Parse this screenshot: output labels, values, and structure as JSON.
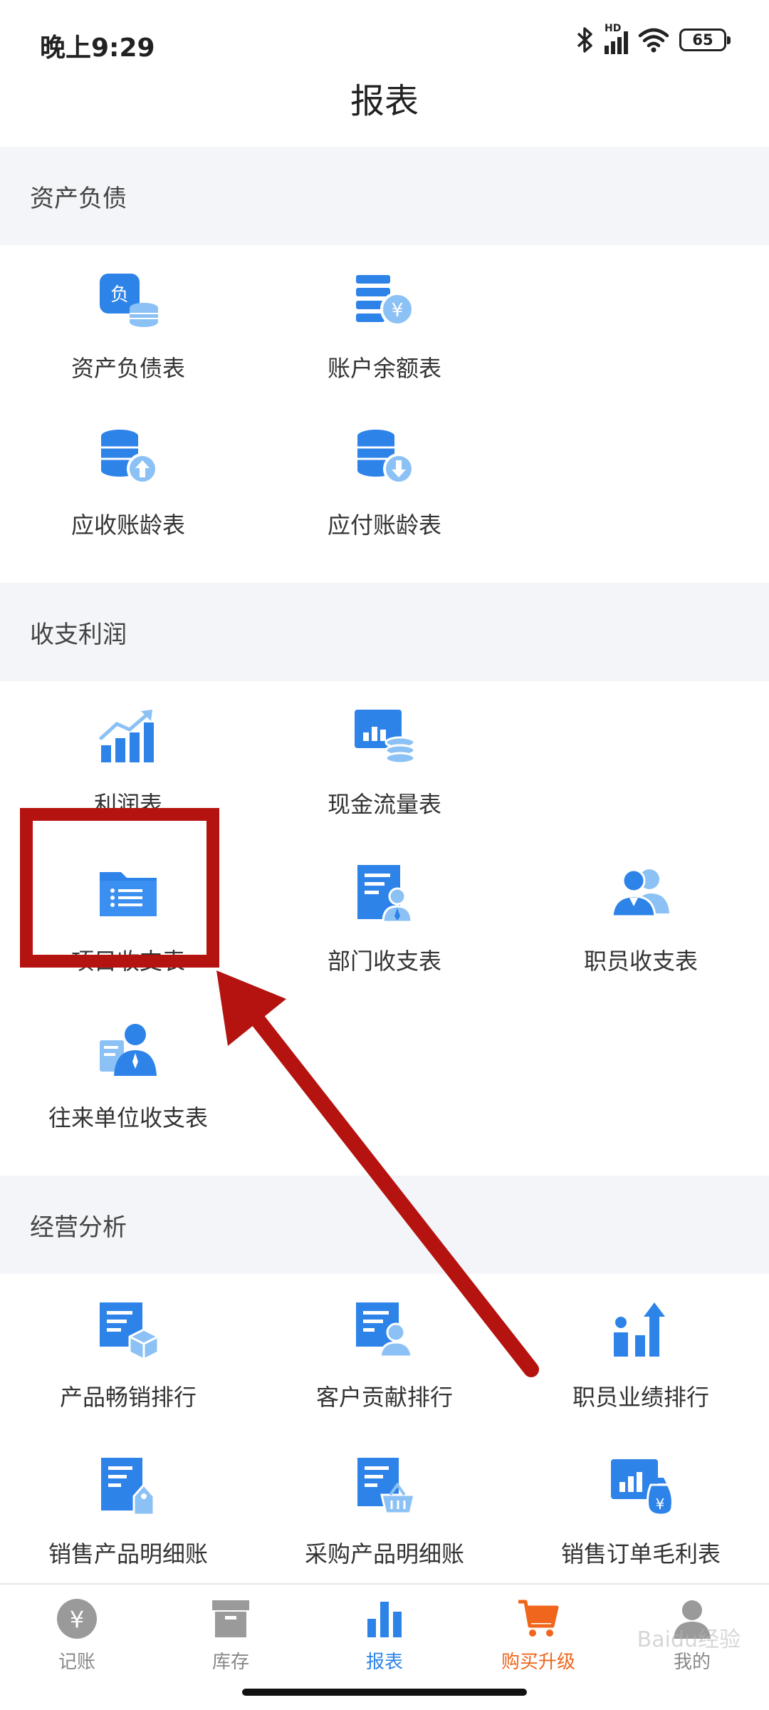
{
  "status_bar": {
    "time": "晚上9:29",
    "network": "HD",
    "battery": "65"
  },
  "page": {
    "title": "报表"
  },
  "sections": [
    {
      "title": "资产负债",
      "items": [
        {
          "label": "资产负债表",
          "icon": "liability-coins-icon"
        },
        {
          "label": "账户余额表",
          "icon": "account-yuan-icon"
        },
        {
          "label": "应收账龄表",
          "icon": "receivable-up-icon"
        },
        {
          "label": "应付账龄表",
          "icon": "payable-down-icon"
        }
      ]
    },
    {
      "title": "收支利润",
      "items": [
        {
          "label": "利润表",
          "icon": "profit-chart-icon"
        },
        {
          "label": "现金流量表",
          "icon": "cashflow-icon"
        },
        {
          "label": "项目收支表",
          "icon": "project-folder-icon"
        },
        {
          "label": "部门收支表",
          "icon": "department-doc-icon"
        },
        {
          "label": "职员收支表",
          "icon": "staff-group-icon"
        },
        {
          "label": "往来单位收支表",
          "icon": "partner-person-icon"
        }
      ]
    },
    {
      "title": "经营分析",
      "items": [
        {
          "label": "产品畅销排行",
          "icon": "product-box-icon"
        },
        {
          "label": "客户贡献排行",
          "icon": "customer-doc-icon"
        },
        {
          "label": "职员业绩排行",
          "icon": "staff-performance-icon"
        },
        {
          "label": "销售产品明细账",
          "icon": "sales-tag-icon"
        },
        {
          "label": "采购产品明细账",
          "icon": "purchase-basket-icon"
        },
        {
          "label": "销售订单毛利表",
          "icon": "order-profit-icon"
        }
      ]
    }
  ],
  "tabbar": [
    {
      "label": "记账",
      "icon": "yuan-circle-icon",
      "state": "normal"
    },
    {
      "label": "库存",
      "icon": "inventory-box-icon",
      "state": "normal"
    },
    {
      "label": "报表",
      "icon": "bar-chart-icon",
      "state": "active"
    },
    {
      "label": "购买升级",
      "icon": "cart-icon",
      "state": "promo"
    },
    {
      "label": "我的",
      "icon": "user-icon",
      "state": "normal"
    }
  ],
  "watermark": "Baidu经验",
  "colors": {
    "icon_blue": "#2d83e8",
    "icon_light": "#8cc1f5",
    "accent_orange": "#f0661c",
    "highlight_red": "#b5130f"
  }
}
